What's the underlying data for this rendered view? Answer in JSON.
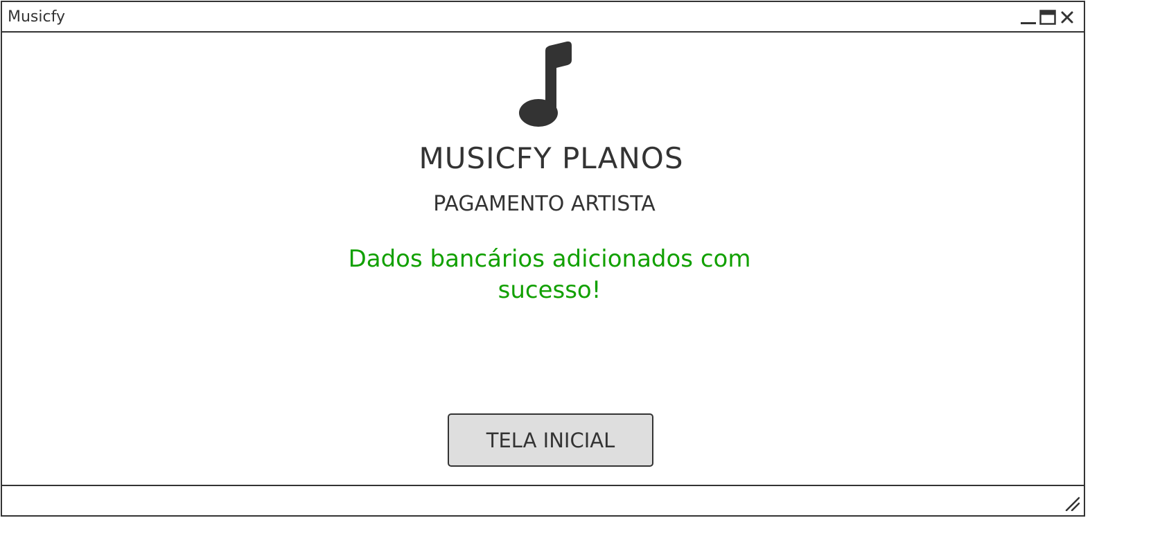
{
  "window": {
    "title": "Musicfy",
    "controls": {
      "minimize_icon": "minimize-icon",
      "maximize_icon": "maximize-icon",
      "close_icon": "close-icon"
    }
  },
  "main": {
    "logo_icon": "music-note-icon",
    "title": "MUSICFY PLANOS",
    "subtitle": "PAGAMENTO ARTISTA",
    "success_message": "Dados bancários adicionados com sucesso!",
    "home_button_label": "TELA INICIAL"
  },
  "statusbar": {
    "resize_icon": "resize-grip-icon"
  },
  "colors": {
    "text": "#333333",
    "success": "#11a000",
    "button_bg": "#dedede",
    "border": "#333333"
  }
}
